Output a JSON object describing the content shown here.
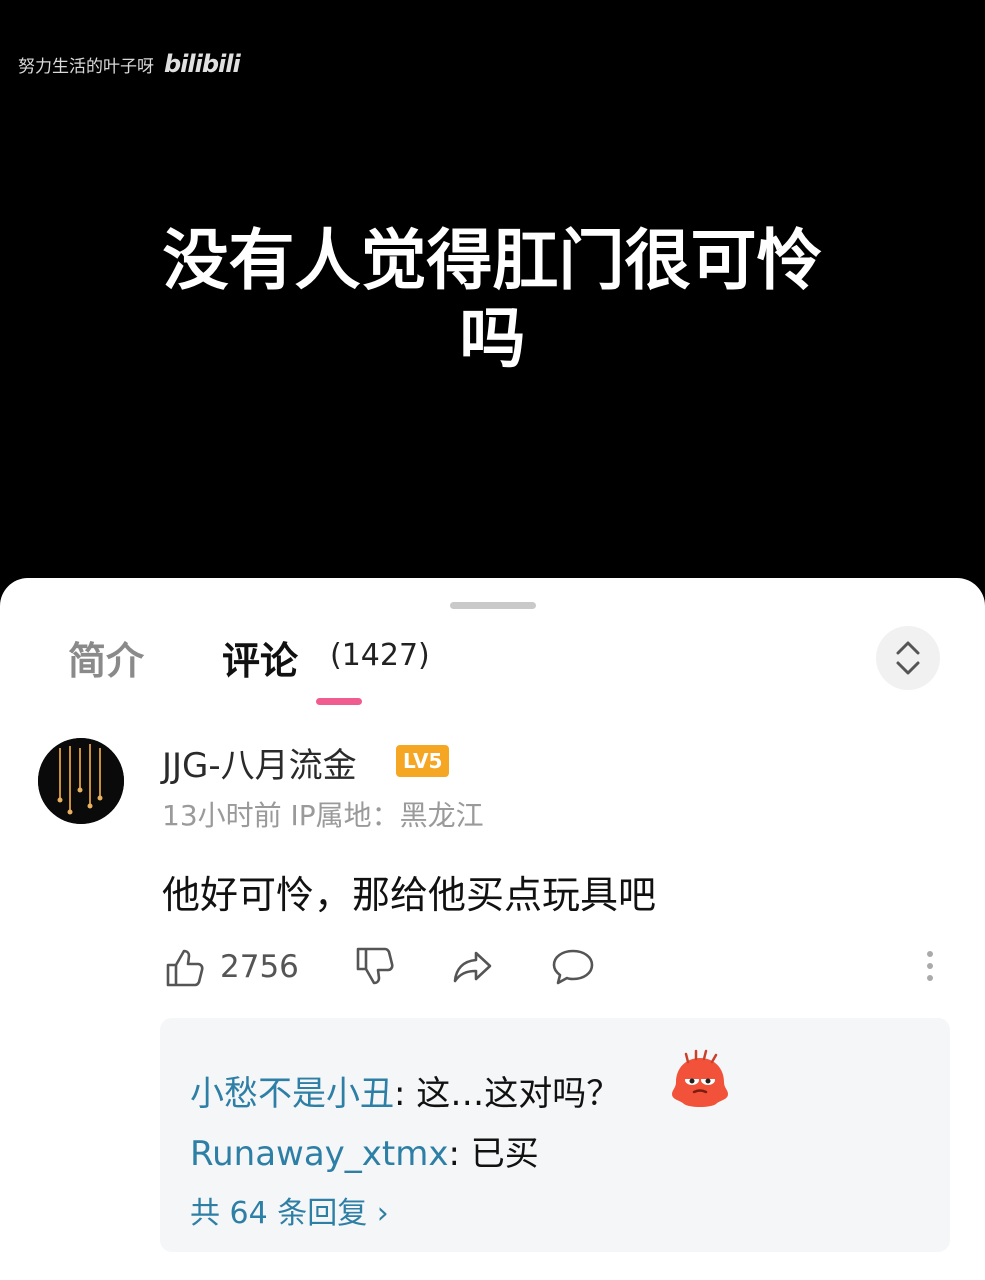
{
  "video": {
    "uploader": "努力生活的叶子呀",
    "platform_logo": "bilibili",
    "caption_line1": "没有人觉得肛门很可怜",
    "caption_line2": "吗"
  },
  "tabs": {
    "intro_label": "简介",
    "comments_label": "评论",
    "comments_count": "(1427)",
    "accent_color": "#f05c8f"
  },
  "comment": {
    "username": "JJG-八月流金",
    "level_badge": "LV5",
    "meta": "13小时前 IP属地：黑龙江",
    "text": "他好可怜，那给他买点玩具吧",
    "likes": "2756"
  },
  "replies": {
    "items": [
      {
        "user": "小愁不是小丑",
        "text": "这…这对吗？",
        "emoji": "angry-red-blob-emoji"
      },
      {
        "user": "Runaway_xtmx",
        "text": "已买"
      }
    ],
    "view_more": "共 64 条回复 ›",
    "link_color": "#2e7fa6"
  },
  "icons": [
    "thumbs-up-icon",
    "thumbs-down-icon",
    "share-icon",
    "reply-bubble-icon",
    "more-vertical-icon",
    "chevron-up-down-icon"
  ]
}
